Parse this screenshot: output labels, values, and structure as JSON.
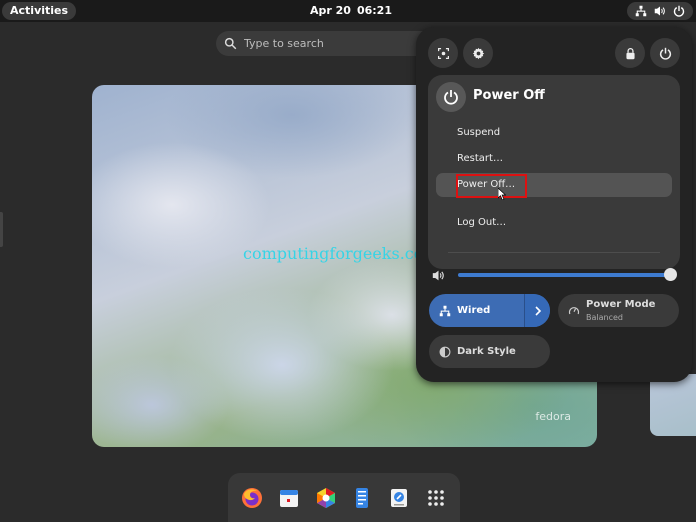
{
  "topbar": {
    "activities": "Activities",
    "date": "Apr 20",
    "time": "06:21",
    "tray_icons": [
      "network-wired-icon",
      "volume-icon",
      "power-icon"
    ]
  },
  "search": {
    "placeholder": "Type to search"
  },
  "watermark": "computingforgeeks.com",
  "wallpaper_mark": "fedora",
  "quick_settings": {
    "top_buttons": [
      "screenshot-icon",
      "settings-icon",
      "lock-icon",
      "power-icon"
    ],
    "power_menu": {
      "title": "Power Off",
      "items": [
        "Suspend",
        "Restart…",
        "Power Off…",
        "Log Out…"
      ],
      "highlighted": "Power Off…"
    },
    "volume": {
      "level": 1.0,
      "icon": "volume-icon"
    },
    "wired": {
      "label": "Wired",
      "active": true
    },
    "power_mode": {
      "label": "Power Mode",
      "value": "Balanced"
    },
    "dark_style": {
      "label": "Dark Style"
    }
  },
  "dock": {
    "apps": [
      "firefox-icon",
      "calendar-icon",
      "software-icon",
      "text-editor-icon",
      "files-icon",
      "app-grid-icon"
    ]
  },
  "colors": {
    "accent": "#3d6cb4",
    "highlight_box": "#dd1111",
    "watermark": "#36d4e6"
  }
}
